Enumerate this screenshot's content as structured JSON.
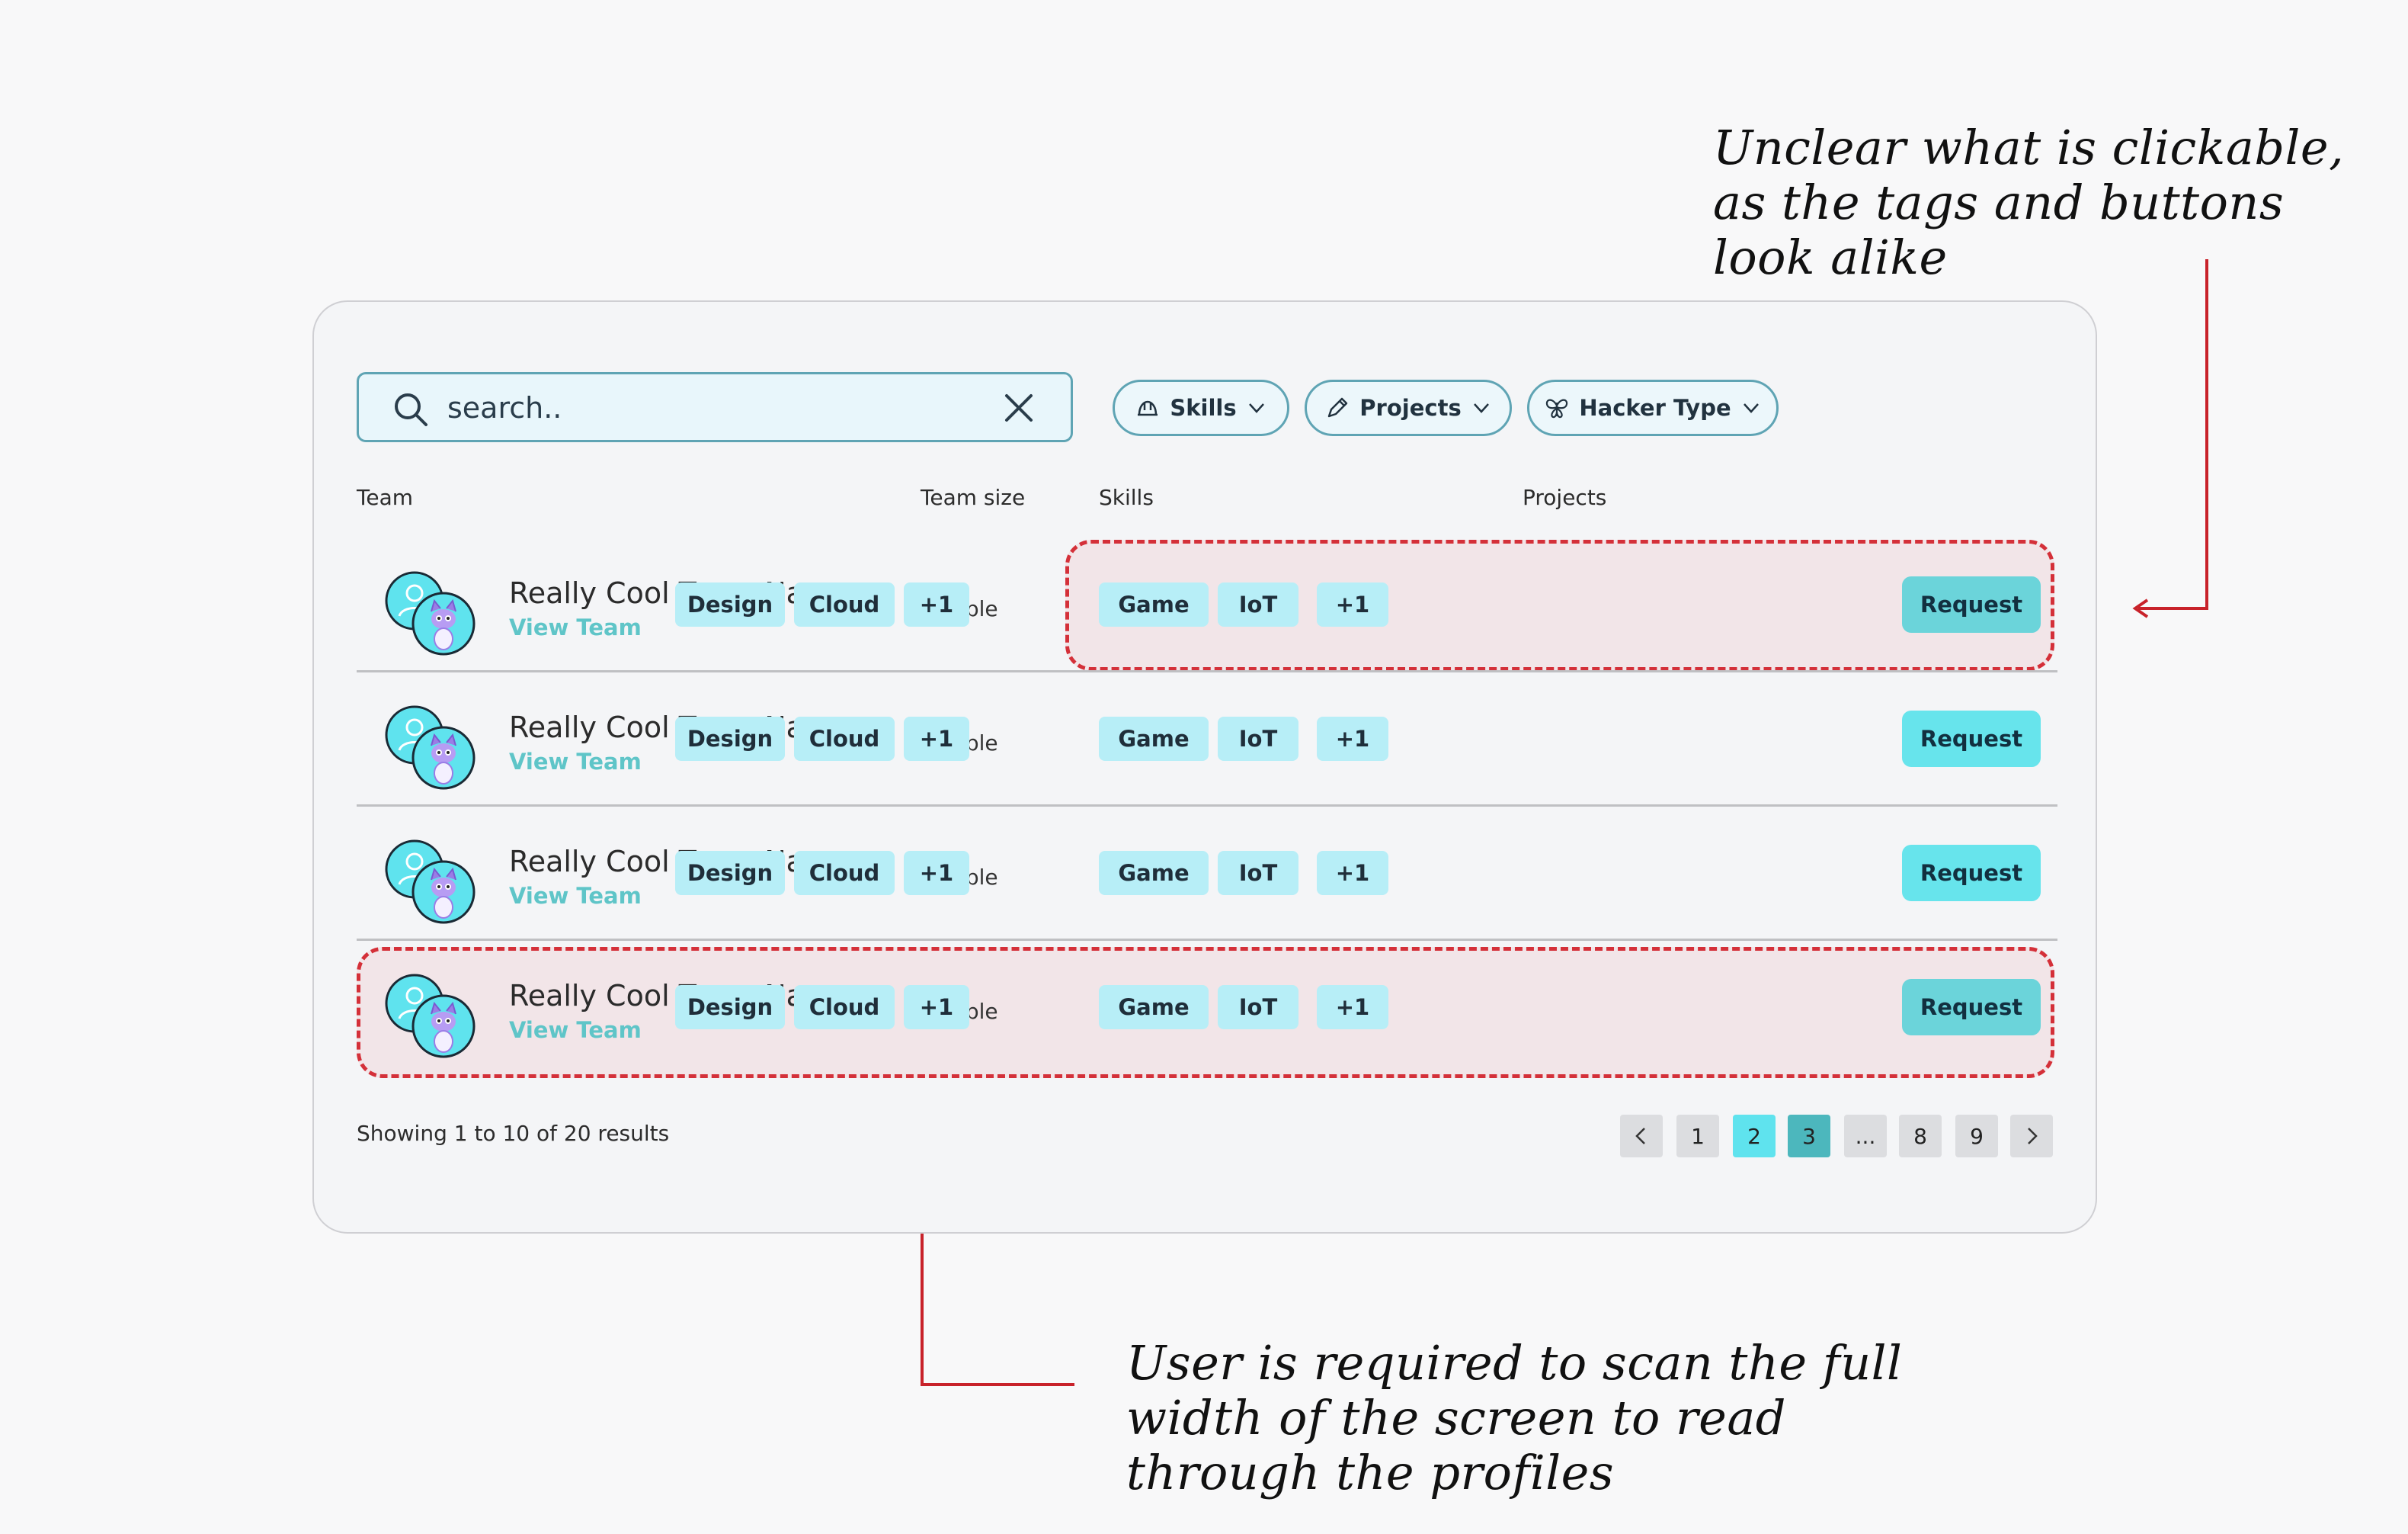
{
  "annotations": {
    "top": "Unclear what is clickable, as the tags and buttons look alike",
    "bottom": "User is required to scan the full width of the screen to read through the profiles"
  },
  "search": {
    "value": "search..",
    "icon": "search-icon",
    "clear_icon": "close-icon"
  },
  "filters": [
    {
      "label": "Skills",
      "icon": "helmet-icon"
    },
    {
      "label": "Projects",
      "icon": "pencil-icon"
    },
    {
      "label": "Hacker Type",
      "icon": "butterfly-icon"
    }
  ],
  "columns": {
    "team": "Team",
    "size": "Team size",
    "skills": "Skills",
    "projects": "Projects"
  },
  "rows": [
    {
      "name": "Really Cool Team Name",
      "link": "View Team",
      "size": "3 people",
      "skills": [
        "Design",
        "Cloud",
        "+1"
      ],
      "projects": [
        "Game",
        "IoT",
        "+1"
      ],
      "action": "Request",
      "highlighted_area": "tags"
    },
    {
      "name": "Really Cool Team Name",
      "link": "View Team",
      "size": "2 people",
      "skills": [
        "Design",
        "Cloud",
        "+1"
      ],
      "projects": [
        "Game",
        "IoT",
        "+1"
      ],
      "action": "Request"
    },
    {
      "name": "Really Cool Team Name",
      "link": "View Team",
      "size": "2 people",
      "skills": [
        "Design",
        "Cloud",
        "+1"
      ],
      "projects": [
        "Game",
        "IoT",
        "+1"
      ],
      "action": "Request"
    },
    {
      "name": "Really Cool Team Name",
      "link": "View Team",
      "size": "3 people",
      "skills": [
        "Design",
        "Cloud",
        "+1"
      ],
      "projects": [
        "Game",
        "IoT",
        "+1"
      ],
      "action": "Request",
      "highlighted_area": "full-row"
    }
  ],
  "footer": {
    "results": "Showing 1 to 10 of 20 results"
  },
  "pagination": {
    "pages": [
      "1",
      "2",
      "3",
      "...",
      "8",
      "9"
    ],
    "current": "3",
    "hover": "2"
  },
  "colors": {
    "accent": "#67e4ec",
    "tag": "#b7eef7",
    "annotation_red": "#c8222a",
    "border": "#5fa4b4"
  }
}
